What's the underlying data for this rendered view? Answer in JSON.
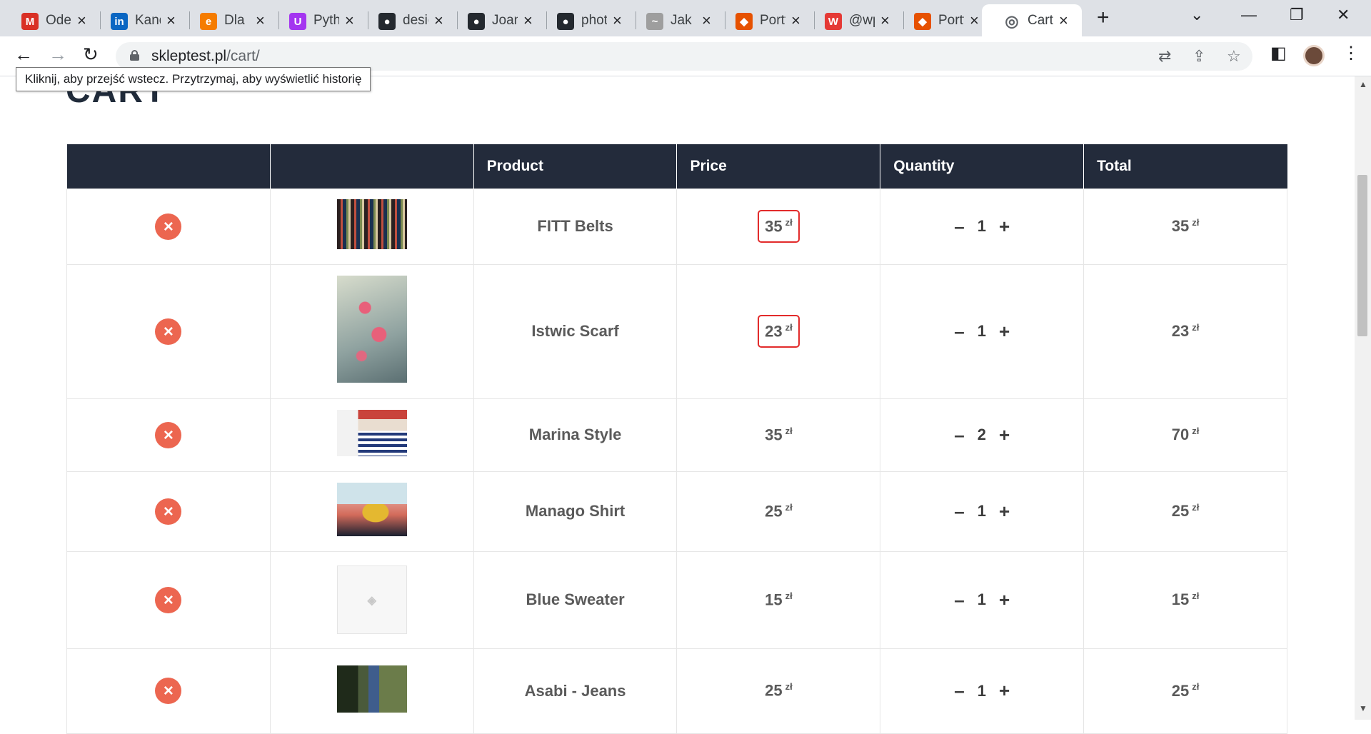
{
  "browser": {
    "tabs": [
      {
        "title": "Odebrane",
        "icon": "gmail-icon",
        "color": "#d93025",
        "glyph": "M"
      },
      {
        "title": "Kandydaci",
        "icon": "linkedin-icon",
        "color": "#0a66c2",
        "glyph": "in"
      },
      {
        "title": "Dla",
        "icon": "swirl-icon",
        "color": "#f57c00",
        "glyph": "e"
      },
      {
        "title": "Python",
        "icon": "udemy-icon",
        "color": "#a435f0",
        "glyph": "U"
      },
      {
        "title": "design",
        "icon": "github-icon",
        "color": "#24292f",
        "glyph": "●"
      },
      {
        "title": "Joanna",
        "icon": "github-icon",
        "color": "#24292f",
        "glyph": "●"
      },
      {
        "title": "photo",
        "icon": "github-icon",
        "color": "#24292f",
        "glyph": "●"
      },
      {
        "title": "Jak",
        "icon": "bird-icon",
        "color": "#9e9e9e",
        "glyph": "~"
      },
      {
        "title": "Portfolio",
        "icon": "flame-icon",
        "color": "#e65100",
        "glyph": "◆"
      },
      {
        "title": "@wp",
        "icon": "wp-icon",
        "color": "#e53935",
        "glyph": "W"
      },
      {
        "title": "Portfolio",
        "icon": "flame-icon",
        "color": "#e65100",
        "glyph": "◆"
      },
      {
        "title": "Cart",
        "icon": "globe-icon",
        "color": "#5f6368",
        "glyph": "◎"
      }
    ],
    "url_host": "skleptest.pl",
    "url_path": "/cart/",
    "tooltip": "Kliknij, aby przejść wstecz. Przytrzymaj, aby wyświetlić historię"
  },
  "page": {
    "heading": "CART",
    "columns": [
      "",
      "",
      "Product",
      "Price",
      "Quantity",
      "Total"
    ],
    "currency": "zł",
    "items": [
      {
        "name": "FITT Belts",
        "price": "35",
        "qty": "1",
        "total": "35",
        "highlighted": true,
        "image": "belts"
      },
      {
        "name": "Istwic Scarf",
        "price": "23",
        "qty": "1",
        "total": "23",
        "highlighted": true,
        "image": "scarf"
      },
      {
        "name": "Marina Style",
        "price": "35",
        "qty": "2",
        "total": "70",
        "highlighted": false,
        "image": "marina"
      },
      {
        "name": "Manago Shirt",
        "price": "25",
        "qty": "1",
        "total": "25",
        "highlighted": false,
        "image": "shirt"
      },
      {
        "name": "Blue Sweater",
        "price": "15",
        "qty": "1",
        "total": "15",
        "highlighted": false,
        "image": "placeholder"
      },
      {
        "name": "Asabi - Jeans",
        "price": "25",
        "qty": "1",
        "total": "25",
        "highlighted": false,
        "image": "jeans"
      }
    ],
    "remove_glyph": "×",
    "minus_glyph": "–",
    "plus_glyph": "+"
  }
}
